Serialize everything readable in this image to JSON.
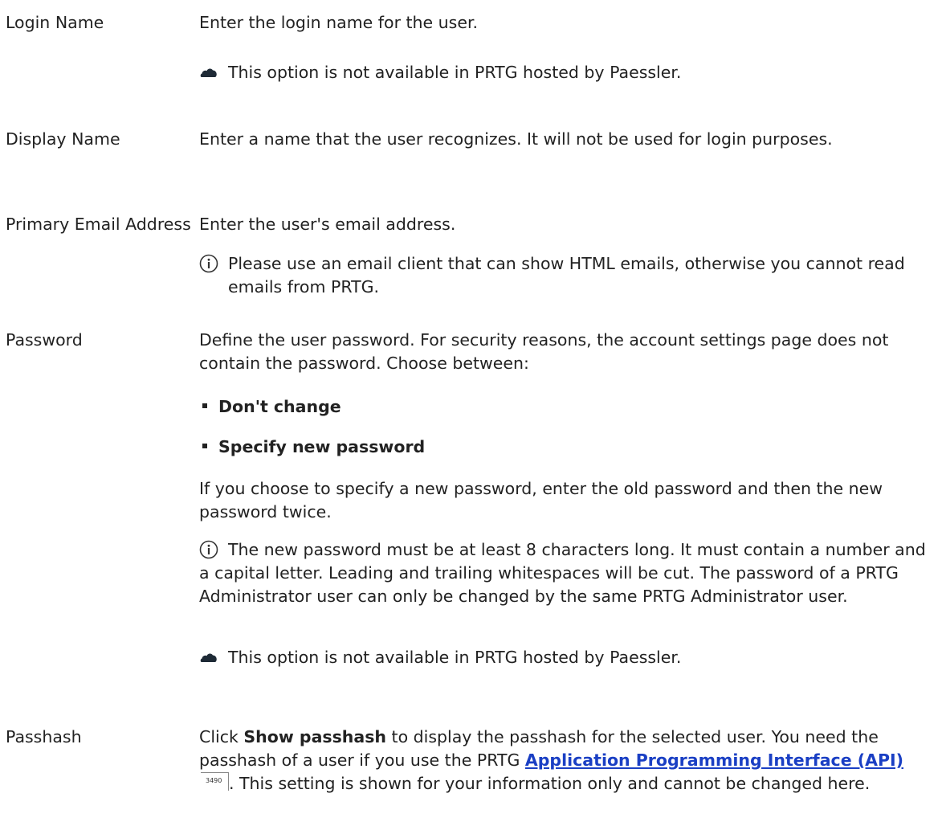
{
  "settings": [
    {
      "label": "Login Name",
      "description": "Enter the login name for the user.",
      "note": "This option is not available in PRTG hosted by Paessler."
    },
    {
      "label": "Display Name",
      "description": "Enter a name that the user recognizes. It will not be used for login purposes."
    },
    {
      "label": "Primary Email Address",
      "description": "Enter the user's email address.",
      "note": "Please use an email client that can show HTML emails, otherwise you cannot read emails from PRTG."
    },
    {
      "label": "Password",
      "description": "Define the user password. For security reasons, the account settings page does not contain the password. Choose between:",
      "options": [
        "Don't change",
        "Specify new password"
      ],
      "description_2": "If you choose to specify a new password, enter the old password and then the new password twice.",
      "note": "The new password must be at least 8 characters long. It must contain a number and a capital letter. Leading and trailing whitespaces will be cut. The password of a PRTG Administrator user can only be changed by the same PRTG Administrator user.",
      "note_2": "This option is not available in PRTG hosted by Paessler."
    },
    {
      "label": "Passhash",
      "desc_before": "Click ",
      "desc_bold": "Show passhash",
      "desc_middle": " to display the passhash for the selected user. You need the passhash of a user if you use the PRTG ",
      "desc_link": "Application Programming Interface (API)",
      "desc_pageref": "3490",
      "desc_after": ". This setting is shown for your information only and cannot be changed here."
    }
  ],
  "icons": {
    "cloud": "cloud-icon",
    "info": "info-icon",
    "cloud_color": "#1e2a36",
    "info_color": "#333333",
    "link_color": "#1a3fc4"
  }
}
